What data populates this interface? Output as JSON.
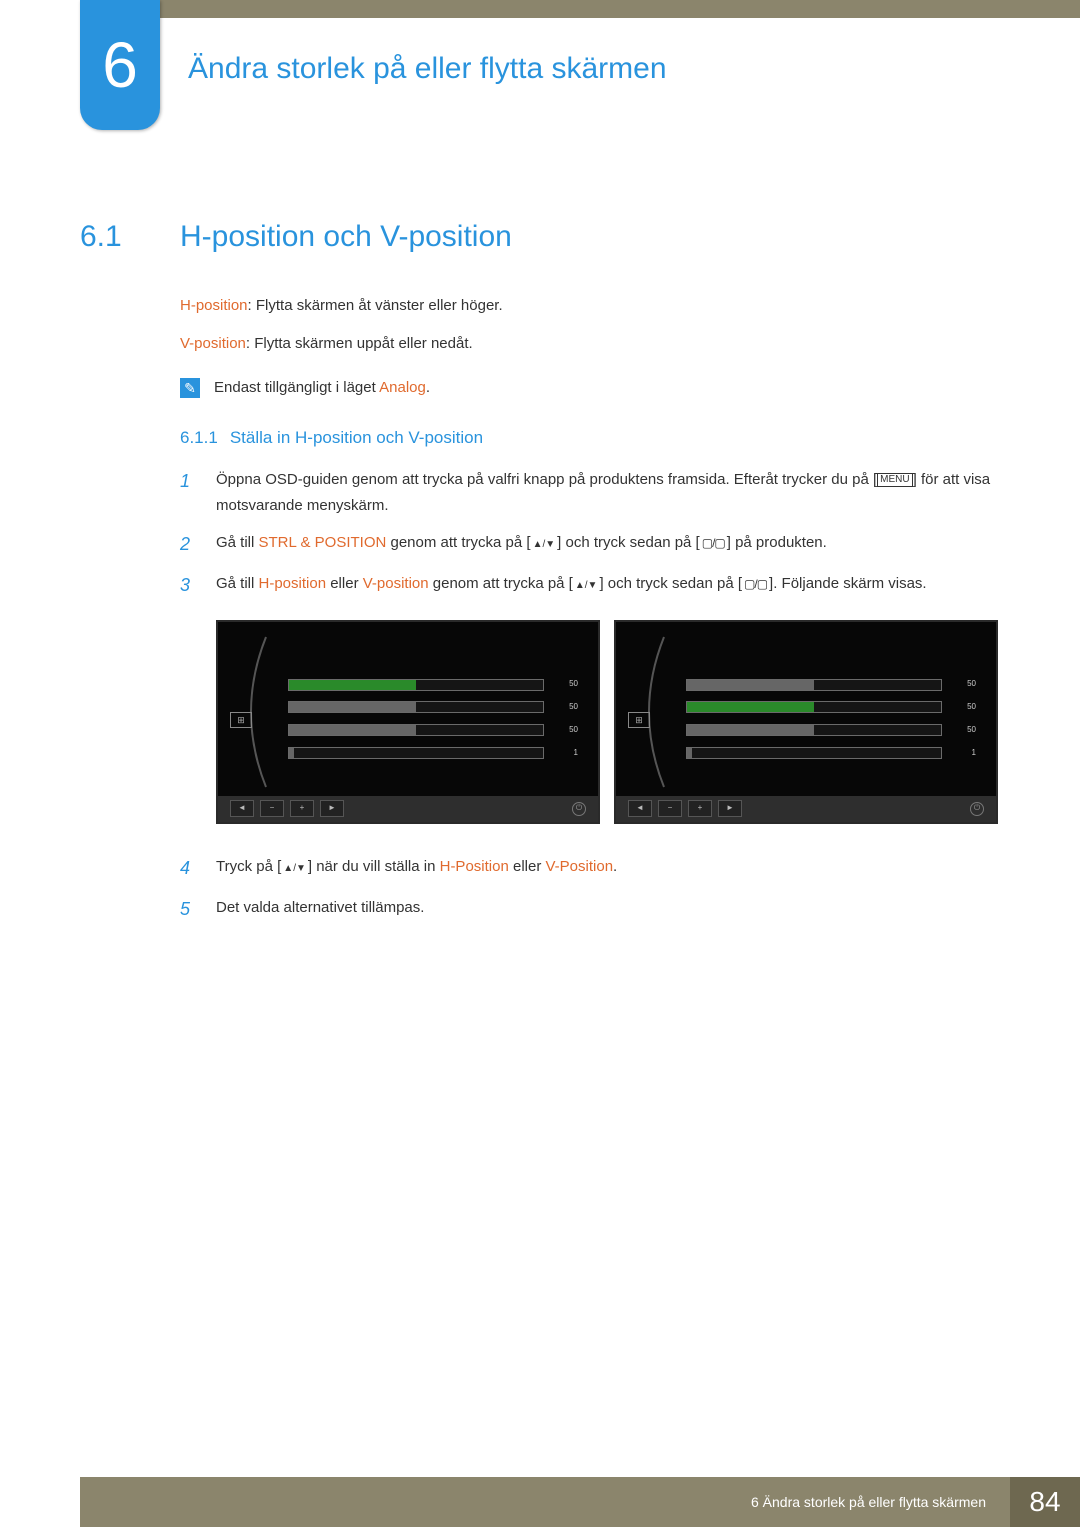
{
  "chapter": {
    "num": "6",
    "title": "Ändra storlek på eller flytta skärmen"
  },
  "section": {
    "num": "6.1",
    "title": "H-position och V-position"
  },
  "desc": {
    "h_label": "H-position",
    "h_text": ": Flytta skärmen åt vänster eller höger.",
    "v_label": "V-position",
    "v_text": ": Flytta skärmen uppåt eller nedåt."
  },
  "note": {
    "pre": "Endast tillgängligt i läget ",
    "mode": "Analog",
    "post": "."
  },
  "subsection": {
    "num": "6.1.1",
    "title": "Ställa in H-position och V-position"
  },
  "steps": {
    "s1_a": "Öppna OSD-guiden genom att trycka på valfri knapp på produktens framsida. Efteråt trycker du på [",
    "s1_menu": "MENU",
    "s1_b": "] för att visa motsvarande menyskärm.",
    "s2_a": "Gå till ",
    "s2_menu": "STRL & POSITION",
    "s2_b": " genom att trycka på [",
    "s2_c": "] och tryck sedan på [",
    "s2_d": "] på produkten.",
    "s3_a": "Gå till ",
    "s3_h": "H-position",
    "s3_or": " eller ",
    "s3_v": "V-position",
    "s3_b": " genom att trycka på [",
    "s3_c": "] och tryck sedan på [",
    "s3_d": "]. Följande skärm visas.",
    "s4_a": "Tryck på [",
    "s4_b": "] när du vill ställa in ",
    "s4_h": "H-Position",
    "s4_or": " eller ",
    "s4_v": "V-Position",
    "s4_end": ".",
    "s5": "Det valda alternativet tillämpas."
  },
  "step_nums": {
    "n1": "1",
    "n2": "2",
    "n3": "3",
    "n4": "4",
    "n5": "5"
  },
  "osd": {
    "left": {
      "r1": "50",
      "r2": "50",
      "r3": "50",
      "r4": "1"
    },
    "right": {
      "r1": "50",
      "r2": "50",
      "r3": "50",
      "r4": "1"
    }
  },
  "footer": {
    "text": "6 Ändra storlek på eller flytta skärmen",
    "page": "84"
  }
}
